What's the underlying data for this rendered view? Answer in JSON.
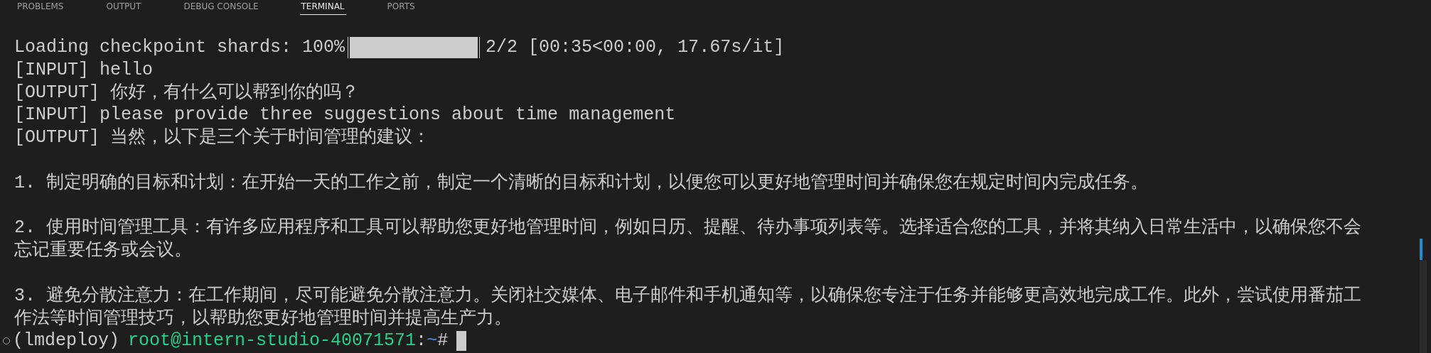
{
  "tabs": [
    {
      "label": "PROBLEMS",
      "selected": false
    },
    {
      "label": "OUTPUT",
      "selected": false
    },
    {
      "label": "DEBUG CONSOLE",
      "selected": false
    },
    {
      "label": "TERMINAL",
      "selected": true
    },
    {
      "label": "PORTS",
      "selected": false
    }
  ],
  "terminal": {
    "lines": [
      {
        "kind": "progress",
        "prefix": "Loading checkpoint shards: 100%",
        "level": 1,
        "suffix": "2/2 [00:35<00:00, 17.67s/it]"
      },
      {
        "kind": "text",
        "text": "[INPUT] hello"
      },
      {
        "kind": "text",
        "text": "[OUTPUT] 你好，有什么可以帮到你的吗？"
      },
      {
        "kind": "text",
        "text": "[INPUT] please provide three suggestions about time management"
      },
      {
        "kind": "text",
        "text": "[OUTPUT] 当然，以下是三个关于时间管理的建议："
      },
      {
        "kind": "blank"
      },
      {
        "kind": "text",
        "text": "1. 制定明确的目标和计划：在开始一天的工作之前，制定一个清晰的目标和计划，以便您可以更好地管理时间并确保您在规定时间内完成任务。"
      },
      {
        "kind": "blank"
      },
      {
        "kind": "text",
        "text": "2. 使用时间管理工具：有许多应用程序和工具可以帮助您更好地管理时间，例如日历、提醒、待办事项列表等。选择适合您的工具，并将其纳入日常生活中，以确保您不会"
      },
      {
        "kind": "text",
        "text": "忘记重要任务或会议。"
      },
      {
        "kind": "blank"
      },
      {
        "kind": "text",
        "text": "3. 避免分散注意力：在工作期间，尽可能避免分散注意力。关闭社交媒体、电子邮件和手机通知等，以确保您专注于任务并能够更高效地完成工作。此外，尝试使用番茄工"
      },
      {
        "kind": "text",
        "text": "作法等时间管理技巧，以帮助您更好地管理时间并提高生产力。"
      },
      {
        "kind": "prompt",
        "env": "(lmdeploy)",
        "user": "root@intern-studio-40071571",
        "sep": ":",
        "path": "~",
        "symbol": "#"
      }
    ]
  }
}
